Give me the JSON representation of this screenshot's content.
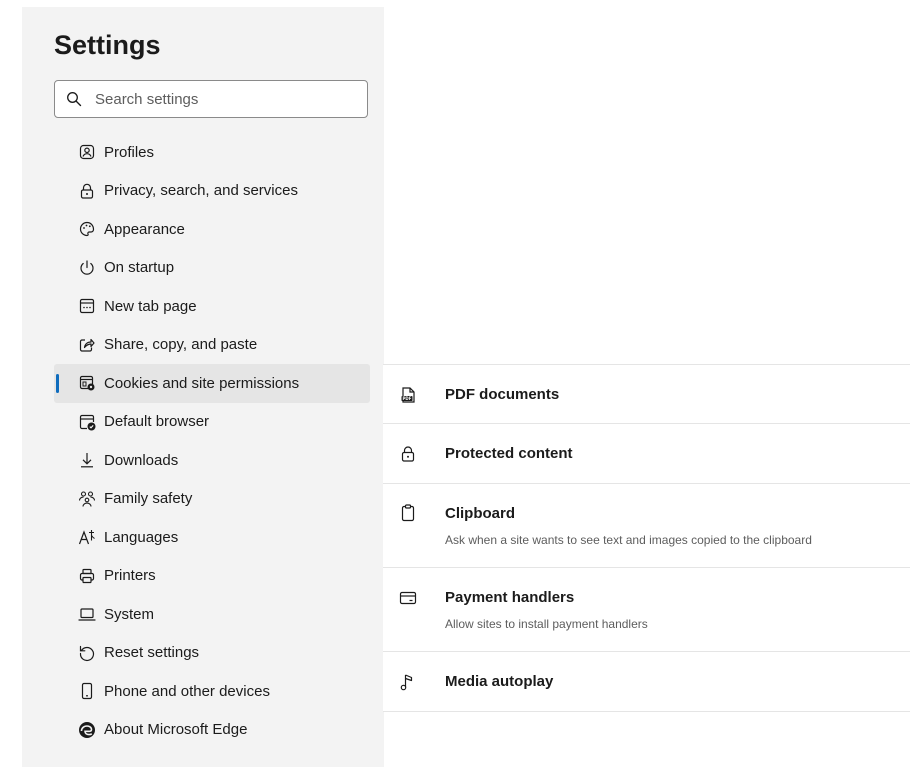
{
  "sidebar": {
    "title": "Settings",
    "search": {
      "placeholder": "Search settings"
    },
    "items": [
      {
        "label": "Profiles",
        "icon": "profile-icon"
      },
      {
        "label": "Privacy, search, and services",
        "icon": "lock-icon"
      },
      {
        "label": "Appearance",
        "icon": "palette-icon"
      },
      {
        "label": "On startup",
        "icon": "power-icon"
      },
      {
        "label": "New tab page",
        "icon": "new-tab-icon"
      },
      {
        "label": "Share, copy, and paste",
        "icon": "share-icon"
      },
      {
        "label": "Cookies and site permissions",
        "icon": "cookies-icon",
        "active": true
      },
      {
        "label": "Default browser",
        "icon": "default-browser-icon"
      },
      {
        "label": "Downloads",
        "icon": "download-icon"
      },
      {
        "label": "Family safety",
        "icon": "family-icon"
      },
      {
        "label": "Languages",
        "icon": "language-icon"
      },
      {
        "label": "Printers",
        "icon": "printer-icon"
      },
      {
        "label": "System",
        "icon": "laptop-icon"
      },
      {
        "label": "Reset settings",
        "icon": "reset-icon"
      },
      {
        "label": "Phone and other devices",
        "icon": "phone-icon"
      },
      {
        "label": "About Microsoft Edge",
        "icon": "edge-logo-icon"
      }
    ]
  },
  "permissions": [
    {
      "title": "PDF documents",
      "description": "",
      "icon": "pdf-icon"
    },
    {
      "title": "Protected content",
      "description": "",
      "icon": "lock-icon"
    },
    {
      "title": "Clipboard",
      "description": "Ask when a site wants to see text and images copied to the clipboard",
      "icon": "clipboard-icon"
    },
    {
      "title": "Payment handlers",
      "description": "Allow sites to install payment handlers",
      "icon": "card-icon"
    },
    {
      "title": "Media autoplay",
      "description": "",
      "icon": "music-note-icon"
    }
  ],
  "colors": {
    "accent": "#0f6cbd",
    "sidebar_bg": "#f3f3f3",
    "active_bg": "#e5e5e5",
    "text": "#1b1b1b",
    "muted": "#5d5d5d"
  }
}
